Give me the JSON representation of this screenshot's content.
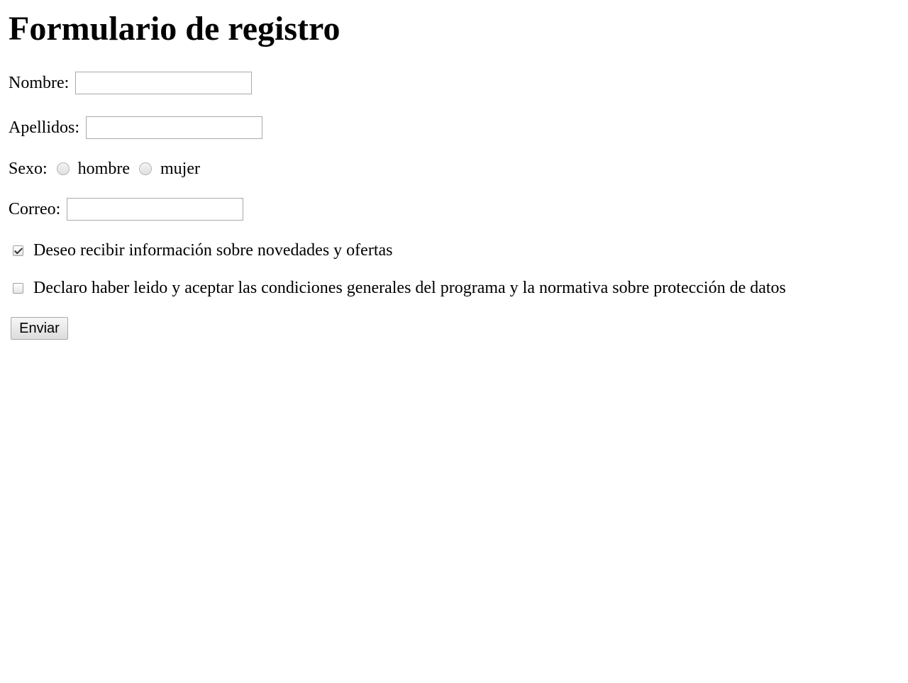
{
  "form": {
    "title": "Formulario de registro",
    "nombre": {
      "label": "Nombre:",
      "value": "",
      "placeholder": ""
    },
    "apellidos": {
      "label": "Apellidos:",
      "value": "",
      "placeholder": ""
    },
    "sexo": {
      "label": "Sexo:",
      "options": [
        {
          "label": "hombre",
          "selected": false
        },
        {
          "label": "mujer",
          "selected": false
        }
      ]
    },
    "correo": {
      "label": "Correo:",
      "value": "",
      "placeholder": ""
    },
    "newsletter": {
      "label": "Deseo recibir información sobre novedades y ofertas",
      "checked": true
    },
    "terms": {
      "label": "Declaro haber leido y aceptar las condiciones generales del programa y la normativa sobre protección de datos",
      "checked": false
    },
    "submit_label": "Enviar"
  },
  "icons": {
    "radio": "radio-unchecked-icon",
    "checkbox_checked": "checkbox-checked-icon",
    "checkbox_unchecked": "checkbox-unchecked-icon"
  },
  "colors": {
    "background": "#ffffff",
    "text": "#000000",
    "input_border": "#a9a9a9"
  }
}
